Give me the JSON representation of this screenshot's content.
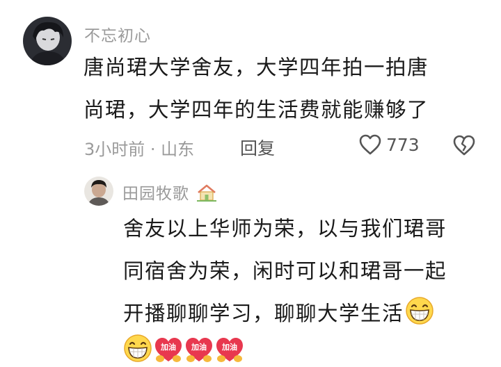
{
  "comment": {
    "username": "不忘初心",
    "text_lines": [
      "唐尚珺大学舍友，大学四年拍一拍唐",
      "尚珺，大学四年的生活费就能赚够了"
    ],
    "time_location": "3小时前 · 山东",
    "reply_label": "回复",
    "like_count": "773"
  },
  "reply": {
    "username": "田园牧歌",
    "username_icon": "house-icon",
    "text_lines": [
      "舍友以上华师为荣，以与我们珺哥",
      "同宿舍为荣，闲时可以和珺哥一起",
      "开播聊聊学习，聊聊大学生活"
    ],
    "sticker_label": "加油"
  },
  "colors": {
    "username": "#9a9a9a",
    "body_text": "#1a1a1a",
    "meta": "#9a9a9a"
  }
}
